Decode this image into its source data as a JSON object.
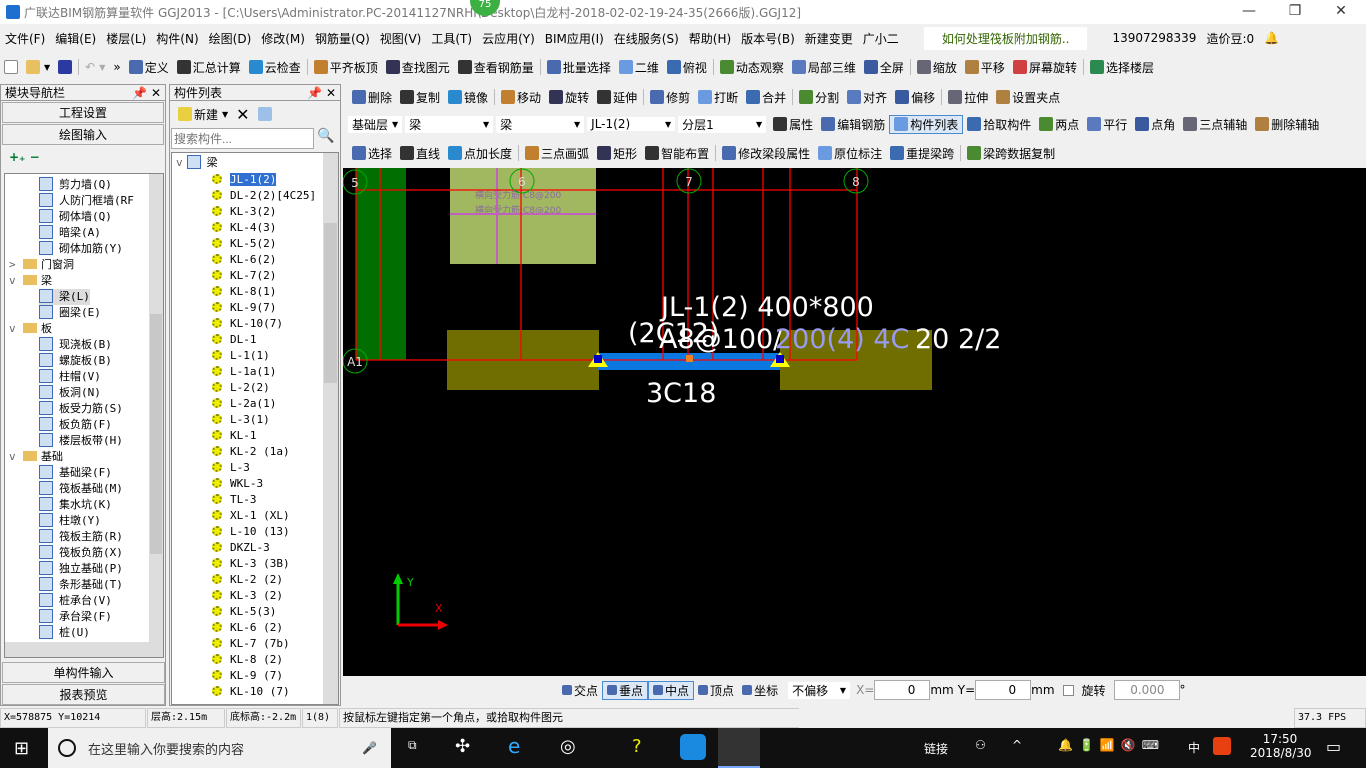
{
  "title": {
    "text": "广联达BIM钢筋算量软件 GGJ2013 - [C:\\Users\\Administrator.PC-20141127NRHI\\Desktop\\白龙村-2018-02-02-19-24-35(2666版).GGJ12]",
    "badge": "75"
  },
  "menu": [
    "文件(F)",
    "编辑(E)",
    "楼层(L)",
    "构件(N)",
    "绘图(D)",
    "修改(M)",
    "钢筋量(Q)",
    "视图(V)",
    "工具(T)",
    "云应用(Y)",
    "BIM应用(I)",
    "在线服务(S)",
    "帮助(H)",
    "版本号(B)",
    "新建变更",
    "广小二"
  ],
  "menu_tip": "如何处理筏板附加钢筋..",
  "account": {
    "phone": "13907298339",
    "beans": "造价豆:0"
  },
  "toolbar1": [
    "定义",
    "汇总计算",
    "云检查",
    "平齐板顶",
    "查找图元",
    "查看钢筋量",
    "批量选择",
    "二维",
    "俯视",
    "动态观察",
    "局部三维",
    "全屏",
    "缩放",
    "平移",
    "屏幕旋转",
    "选择楼层"
  ],
  "toolbar2": [
    "删除",
    "复制",
    "镜像",
    "移动",
    "旋转",
    "延伸",
    "修剪",
    "打断",
    "合并",
    "分割",
    "对齐",
    "偏移",
    "拉伸",
    "设置夹点"
  ],
  "toolbar3": {
    "selects": [
      "基础层",
      "梁",
      "梁",
      "JL-1(2)",
      "分层1"
    ],
    "buttons": [
      "属性",
      "编辑钢筋",
      "构件列表",
      "拾取构件",
      "两点",
      "平行",
      "点角",
      "三点辅轴",
      "删除辅轴"
    ]
  },
  "toolbar4": [
    "选择",
    "直线",
    "点加长度",
    "三点画弧",
    "矩形",
    "智能布置",
    "修改梁段属性",
    "原位标注",
    "重提梁跨",
    "梁跨数据复制"
  ],
  "nav": {
    "title": "模块导航栏",
    "btn_top": [
      "工程设置",
      "绘图输入"
    ],
    "btn_bottom": [
      "单构件输入",
      "报表预览"
    ],
    "tree": [
      {
        "l": "剪力墙(Q)",
        "lv": 2
      },
      {
        "l": "人防门框墙(RF",
        "lv": 2
      },
      {
        "l": "砌体墙(Q)",
        "lv": 2
      },
      {
        "l": "暗梁(A)",
        "lv": 2
      },
      {
        "l": "砌体加筋(Y)",
        "lv": 2
      },
      {
        "l": "门窗洞",
        "lv": 1,
        "f": ">"
      },
      {
        "l": "梁",
        "lv": 1,
        "f": "v"
      },
      {
        "l": "梁(L)",
        "lv": 2,
        "sel": true
      },
      {
        "l": "圈梁(E)",
        "lv": 2
      },
      {
        "l": "板",
        "lv": 1,
        "f": "v"
      },
      {
        "l": "现浇板(B)",
        "lv": 2
      },
      {
        "l": "螺旋板(B)",
        "lv": 2
      },
      {
        "l": "柱帽(V)",
        "lv": 2
      },
      {
        "l": "板洞(N)",
        "lv": 2
      },
      {
        "l": "板受力筋(S)",
        "lv": 2
      },
      {
        "l": "板负筋(F)",
        "lv": 2
      },
      {
        "l": "楼层板带(H)",
        "lv": 2
      },
      {
        "l": "基础",
        "lv": 1,
        "f": "v"
      },
      {
        "l": "基础梁(F)",
        "lv": 2
      },
      {
        "l": "筏板基础(M)",
        "lv": 2
      },
      {
        "l": "集水坑(K)",
        "lv": 2
      },
      {
        "l": "柱墩(Y)",
        "lv": 2
      },
      {
        "l": "筏板主筋(R)",
        "lv": 2
      },
      {
        "l": "筏板负筋(X)",
        "lv": 2
      },
      {
        "l": "独立基础(P)",
        "lv": 2
      },
      {
        "l": "条形基础(T)",
        "lv": 2
      },
      {
        "l": "桩承台(V)",
        "lv": 2
      },
      {
        "l": "承台梁(F)",
        "lv": 2
      },
      {
        "l": "桩(U)",
        "lv": 2
      }
    ]
  },
  "complist": {
    "title": "构件列表",
    "new": "新建",
    "search_placeholder": "搜索构件...",
    "root": "梁",
    "items": [
      "JL-1(2)",
      "DL-2(2)[4C25]",
      "KL-3(2)",
      "KL-4(3)",
      "KL-5(2)",
      "KL-6(2)",
      "KL-7(2)",
      "KL-8(1)",
      "KL-9(7)",
      "KL-10(7)",
      "DL-1",
      "L-1(1)",
      "L-1a(1)",
      "L-2(2)",
      "L-2a(1)",
      "L-3(1)",
      "KL-1",
      "KL-2 (1a)",
      "L-3",
      "WKL-3",
      "TL-3",
      "XL-1 (XL)",
      "L-10 (13)",
      "DKZL-3",
      "KL-3 (3B)",
      "KL-2 (2)",
      "KL-3 (2)",
      "KL-5(3)",
      "KL-6 (2)",
      "KL-7 (7b)",
      "KL-8 (2)",
      "KL-9 (7)",
      "KL-10 (7)"
    ]
  },
  "canvas": {
    "axes": [
      "5",
      "6",
      "7",
      "8",
      "A1"
    ],
    "slab_text": [
      "横向受力筋:C8@200",
      "横向受力筋:C8@200"
    ],
    "beam_label1": "JL-1(2) 400*800",
    "beam_label2a": "(2C12)",
    "beam_label2b": "A8@100/",
    "beam_label2c": "200(4) 4C",
    "beam_label2d": "20 2/2",
    "beam_bottom": "3C18",
    "axis_x": "X",
    "axis_y": "Y"
  },
  "snap": {
    "items": [
      "交点",
      "垂点",
      "中点",
      "顶点",
      "坐标"
    ],
    "offset": "不偏移",
    "x_label": "X=",
    "x_value": "0",
    "y_label": "Y=",
    "y_value": "0",
    "unit": "mm",
    "rotate_label": "旋转",
    "rotate_value": "0.000",
    "degree": "°"
  },
  "status": {
    "coords": "X=578875 Y=10214",
    "floor_height": "层高:2.15m",
    "base_height": "底标高:-2.2m",
    "count": "1(8)",
    "hint": "按鼠标左键指定第一个角点，或拾取构件图元",
    "fps": "37.3 FPS"
  },
  "taskbar": {
    "search": "在这里输入你要搜索的内容",
    "link": "链接",
    "ime": "中",
    "time": "17:50",
    "date": "2018/8/30"
  },
  "colors": {
    "canvas": "#000000",
    "grid": "#ff0000",
    "beam": "#0a78e0",
    "slab": "#a2b860",
    "column": "#006e00",
    "footing": "#706e00"
  }
}
